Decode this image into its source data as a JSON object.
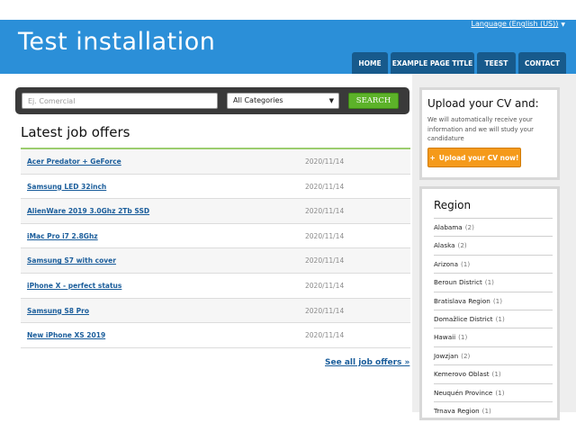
{
  "header": {
    "site_title": "Test installation",
    "language_link": "Language (English (US))",
    "nav": [
      "HOME",
      "EXAMPLE PAGE TITLE",
      "TEEST",
      "CONTACT"
    ]
  },
  "search": {
    "placeholder": "Ej. Comercial",
    "category_value": "All Categories",
    "button_label": "SEARCH"
  },
  "jobs": {
    "title": "Latest job offers",
    "items": [
      {
        "title": "Acer Predator + GeForce",
        "date": "2020/11/14"
      },
      {
        "title": "Samsung LED 32inch",
        "date": "2020/11/14"
      },
      {
        "title": "AlienWare 2019 3.0Ghz 2Tb SSD",
        "date": "2020/11/14"
      },
      {
        "title": "iMac Pro i7 2.8Ghz",
        "date": "2020/11/14"
      },
      {
        "title": "Samsung S7 with cover",
        "date": "2020/11/14"
      },
      {
        "title": "iPhone X - perfect status",
        "date": "2020/11/14"
      },
      {
        "title": "Samsung S8 Pro",
        "date": "2020/11/14"
      },
      {
        "title": "New iPhone XS 2019",
        "date": "2020/11/14"
      }
    ],
    "see_all": "See all job offers »"
  },
  "cv": {
    "title": "Upload your CV and:",
    "text": "We will automatically receive your information and we will study your candidature",
    "button_label": "Upload your CV now!"
  },
  "region": {
    "title": "Region",
    "items": [
      {
        "name": "Alabama",
        "count": "(2)"
      },
      {
        "name": "Alaska",
        "count": "(2)"
      },
      {
        "name": "Arizona",
        "count": "(1)"
      },
      {
        "name": "Beroun District",
        "count": "(1)"
      },
      {
        "name": "Bratislava Region",
        "count": "(1)"
      },
      {
        "name": "Domažlice District",
        "count": "(1)"
      },
      {
        "name": "Hawaii",
        "count": "(1)"
      },
      {
        "name": "Jowzjan",
        "count": "(2)"
      },
      {
        "name": "Kemerovo Oblast",
        "count": "(1)"
      },
      {
        "name": "Neuquén Province",
        "count": "(1)"
      },
      {
        "name": "Trnava Region",
        "count": "(1)"
      }
    ]
  },
  "colors": {
    "header_blue": "#2b8fd8",
    "nav_blue": "#175a8c",
    "search_green": "#5cb229",
    "cv_orange": "#f59a1a",
    "link_blue": "#1a5d9b"
  }
}
